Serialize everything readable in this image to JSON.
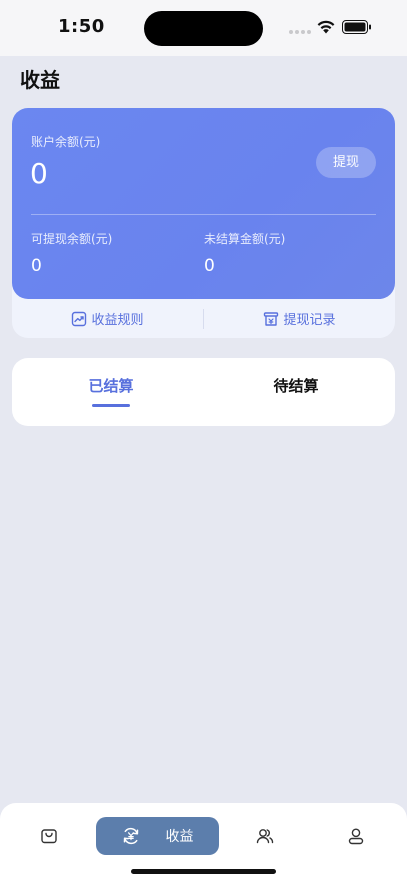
{
  "status_bar": {
    "time": "1:50"
  },
  "page": {
    "title": "收益"
  },
  "balance_card": {
    "balance_label": "账户余额(元)",
    "balance_value": "0",
    "withdraw_button": "提现",
    "withdrawable_label": "可提现余额(元)",
    "withdrawable_value": "0",
    "unsettled_label": "未结算金额(元)",
    "unsettled_value": "0"
  },
  "card_links": {
    "rules": "收益规则",
    "records": "提现记录"
  },
  "tabs": [
    {
      "label": "已结算",
      "active": true
    },
    {
      "label": "待结算",
      "active": false
    }
  ],
  "bottom_nav": {
    "items": [
      {
        "icon": "shopping-bag-icon"
      },
      {
        "icon": "earnings-icon",
        "label": "收益",
        "active": true
      },
      {
        "icon": "users-icon"
      },
      {
        "icon": "profile-icon"
      }
    ]
  },
  "colors": {
    "accent": "#5870dd",
    "card_gradient": "#6b87f0",
    "nav_active": "#5c7eac",
    "background": "#e6e8f1"
  }
}
